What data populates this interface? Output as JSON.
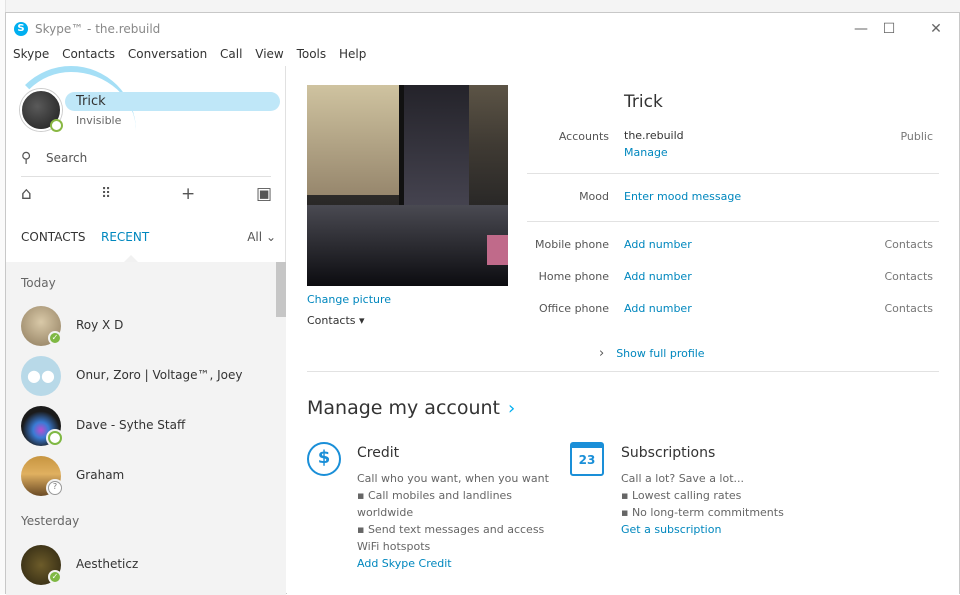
{
  "window": {
    "title": "Skype™ - the.rebuild",
    "logo_letter": "S",
    "minimize": "—",
    "maximize": "☐",
    "close": "✕"
  },
  "menu": [
    "Skype",
    "Contacts",
    "Conversation",
    "Call",
    "View",
    "Tools",
    "Help"
  ],
  "me": {
    "name": "Trick",
    "status": "Invisible"
  },
  "search": {
    "label": "Search"
  },
  "tabs": {
    "contacts": "CONTACTS",
    "recent": "RECENT",
    "filter": "All"
  },
  "recent": {
    "today_label": "Today",
    "yesterday_label": "Yesterday",
    "items": [
      {
        "name": "Roy X D",
        "presence": "online"
      },
      {
        "name": "Onur, Zoro | Voltage™, Joey",
        "presence": "group"
      },
      {
        "name": "Dave - Sythe Staff",
        "presence": "away"
      },
      {
        "name": "Graham",
        "presence": "unknown"
      },
      {
        "name": "Aestheticz",
        "presence": "online"
      }
    ]
  },
  "profile": {
    "name": "Trick",
    "change_picture": "Change picture",
    "picture_visibility": "Contacts ▾",
    "fields": {
      "accounts_label": "Accounts",
      "accounts_value": "the.rebuild",
      "accounts_manage": "Manage",
      "accounts_scope": "Public",
      "mood_label": "Mood",
      "mood_link": "Enter mood message",
      "mobile_label": "Mobile phone",
      "mobile_link": "Add number",
      "mobile_scope": "Contacts",
      "home_label": "Home phone",
      "home_link": "Add number",
      "home_scope": "Contacts",
      "office_label": "Office phone",
      "office_link": "Add number",
      "office_scope": "Contacts"
    },
    "show_full": "Show full profile"
  },
  "manage": {
    "title": "Manage my account",
    "credit": {
      "title": "Credit",
      "lines": [
        "Call who you want, when you want",
        "▪ Call mobiles and landlines",
        "worldwide",
        "▪ Send text messages and access",
        "WiFi hotspots"
      ],
      "link": "Add Skype Credit",
      "icon_glyph": "$"
    },
    "subscriptions": {
      "title": "Subscriptions",
      "lines": [
        "Call a lot? Save a lot...",
        "▪ Lowest calling rates",
        "▪ No long-term commitments"
      ],
      "link": "Get a subscription",
      "icon_glyph": "23"
    }
  },
  "colors": {
    "accent": "#00aff0",
    "link": "#0087be",
    "online": "#7fb843"
  }
}
